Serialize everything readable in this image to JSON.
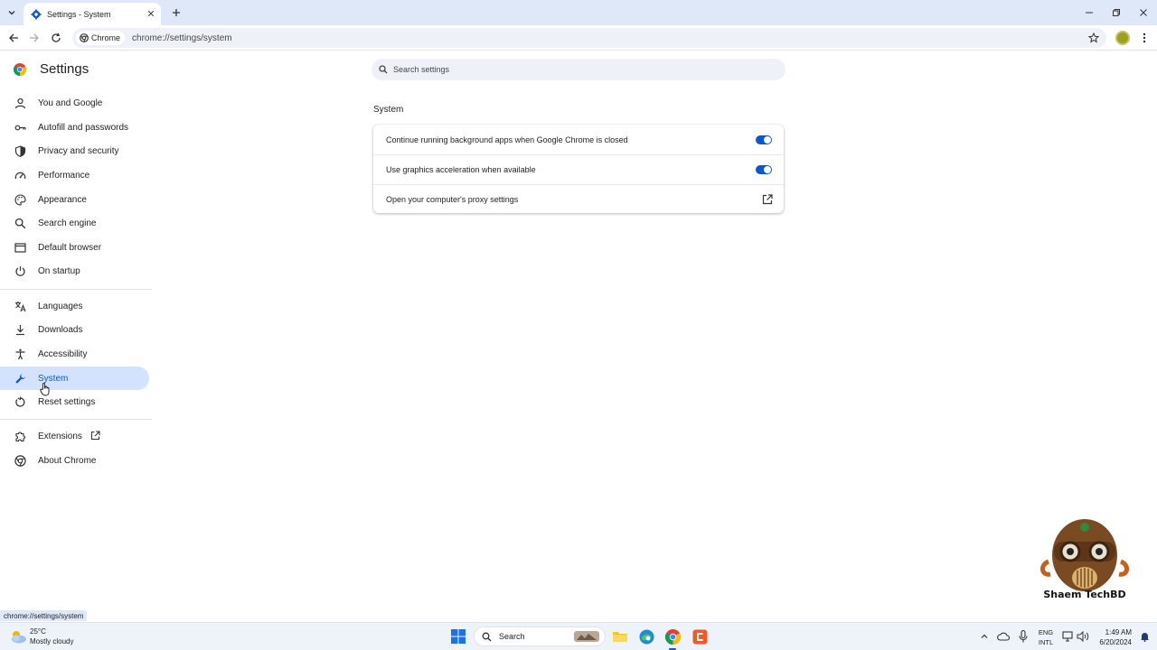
{
  "browser": {
    "tab_title": "Settings - System",
    "chip_label": "Chrome",
    "url": "chrome://settings/system"
  },
  "settings": {
    "title": "Settings",
    "search_placeholder": "Search settings"
  },
  "sidebar": {
    "items": [
      {
        "label": "You and Google",
        "icon": "person-icon"
      },
      {
        "label": "Autofill and passwords",
        "icon": "key-icon"
      },
      {
        "label": "Privacy and security",
        "icon": "shield-icon"
      },
      {
        "label": "Performance",
        "icon": "speedometer-icon"
      },
      {
        "label": "Appearance",
        "icon": "palette-icon"
      },
      {
        "label": "Search engine",
        "icon": "search-icon"
      },
      {
        "label": "Default browser",
        "icon": "browser-window-icon"
      },
      {
        "label": "On startup",
        "icon": "power-icon"
      },
      {
        "label": "Languages",
        "icon": "translate-icon"
      },
      {
        "label": "Downloads",
        "icon": "download-icon"
      },
      {
        "label": "Accessibility",
        "icon": "accessibility-icon"
      },
      {
        "label": "System",
        "icon": "wrench-icon",
        "active": true
      },
      {
        "label": "Reset settings",
        "icon": "reset-icon"
      },
      {
        "label": "Extensions",
        "icon": "puzzle-icon"
      },
      {
        "label": "About Chrome",
        "icon": "chrome-icon"
      }
    ]
  },
  "main": {
    "section_title": "System",
    "rows": [
      {
        "label": "Continue running background apps when Google Chrome is closed",
        "control": "toggle",
        "enabled": true
      },
      {
        "label": "Use graphics acceleration when available",
        "control": "toggle",
        "enabled": true
      },
      {
        "label": "Open your computer's proxy settings",
        "control": "launch-icon"
      }
    ]
  },
  "status_bubble": "chrome://settings/system",
  "watermark": {
    "text": "Shaem TechBD"
  },
  "taskbar": {
    "weather_temp": "25°C",
    "weather_desc": "Mostly cloudy",
    "search_label": "Search",
    "lang_top": "ENG",
    "lang_bottom": "INTL",
    "time": "1:49 AM",
    "date": "6/20/2024"
  },
  "colors": {
    "accent": "#0b57d0",
    "active_nav_bg": "#d3e3fd",
    "tabstrip_bg": "#dfe8f9"
  }
}
